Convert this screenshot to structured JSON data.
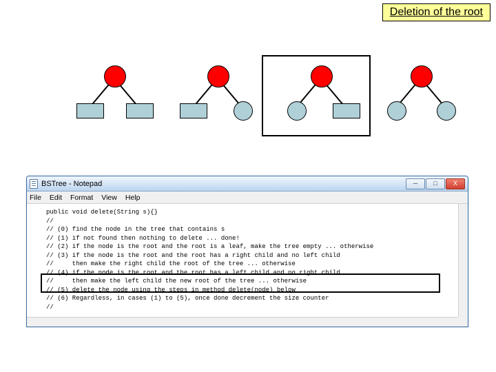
{
  "title": "Deletion of the root",
  "notepad": {
    "window_title": "BSTree - Notepad",
    "menu": [
      "File",
      "Edit",
      "Format",
      "View",
      "Help"
    ],
    "controls": {
      "min": "─",
      "max": "□",
      "close": "X"
    },
    "code_lines": [
      "public void delete(String s){}",
      "//",
      "// (0) find the node in the tree that contains s",
      "// (1) if not found then nothing to delete ... done!",
      "// (2) if the node is the root and the root is a leaf, make the tree empty ... otherwise",
      "// (3) if the node is the root and the root has a right child and no left child",
      "//     then make the right child the root of the tree ... otherwise",
      "// (4) if the node is the root and the root has a left child and no right child",
      "//     then make the left child the new root of the tree ... otherwise",
      "// (5) delete the node using the steps in method delete(node) below",
      "// (6) Regardless, in cases (1) to (5), once done decrement the size counter",
      "//"
    ]
  },
  "trees": [
    {
      "id": 1,
      "root": "red-circle",
      "left": "rect",
      "right": "rect",
      "highlighted": false
    },
    {
      "id": 2,
      "root": "red-circle",
      "left": "rect",
      "right": "circle",
      "highlighted": false
    },
    {
      "id": 3,
      "root": "red-circle",
      "left": "circle",
      "right": "rect",
      "highlighted": true
    },
    {
      "id": 4,
      "root": "red-circle",
      "left": "circle",
      "right": "circle",
      "highlighted": false
    }
  ]
}
